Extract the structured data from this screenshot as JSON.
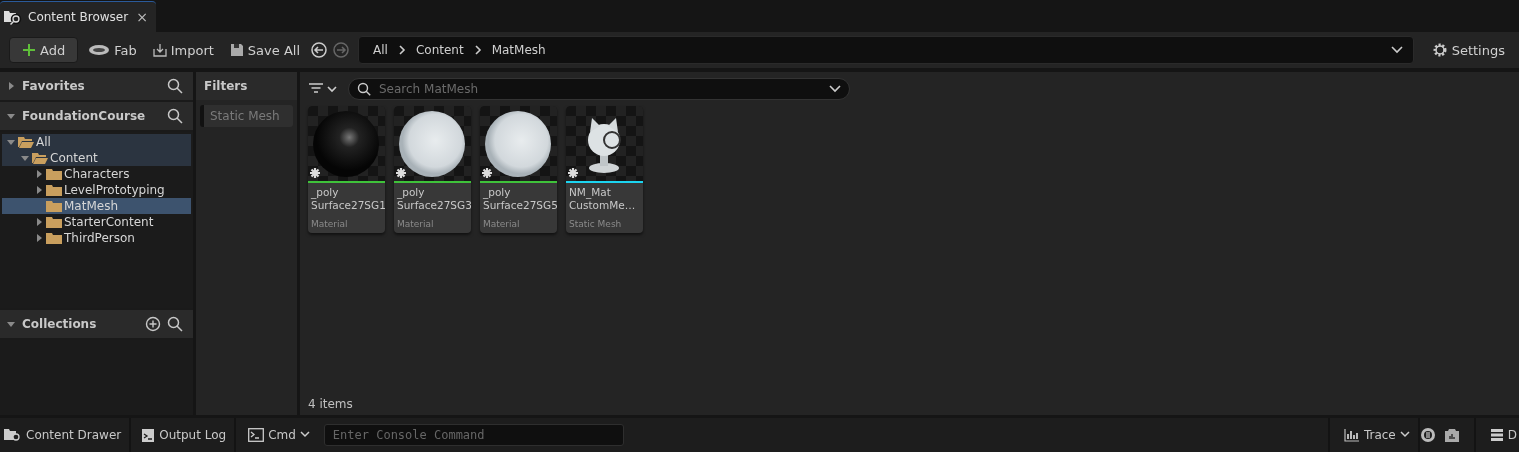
{
  "tab": {
    "title": "Content Browser",
    "close": "×"
  },
  "toolbar": {
    "buttons": [
      {
        "kind": "add",
        "label": "Add"
      },
      {
        "kind": "fab",
        "label": "Fab"
      },
      {
        "kind": "import",
        "label": "Import"
      },
      {
        "kind": "save",
        "label": "Save All"
      }
    ],
    "breadcrumb": [
      "All",
      "Content",
      "MatMesh"
    ],
    "settings": "Settings"
  },
  "sidebar": {
    "favorites": {
      "title": "Favorites",
      "expanded": false
    },
    "project": {
      "title": "FoundationCourse",
      "expanded": true
    },
    "tree": [
      {
        "label": "All",
        "expanded": true,
        "selected": false,
        "children": [
          {
            "label": "Content",
            "expanded": true,
            "selected": false,
            "children": [
              {
                "label": "Characters",
                "expanded": false,
                "selected": false
              },
              {
                "label": "LevelPrototyping",
                "expanded": false,
                "selected": false
              },
              {
                "label": "MatMesh",
                "selected": true
              },
              {
                "label": "StarterContent",
                "expanded": false,
                "selected": false
              },
              {
                "label": "ThirdPerson",
                "expanded": false,
                "selected": false
              }
            ]
          }
        ]
      }
    ],
    "collections": {
      "title": "Collections",
      "expanded": true
    }
  },
  "filters": {
    "title": "Filters",
    "chips": [
      {
        "label": "Static Mesh",
        "checked": false
      }
    ]
  },
  "search": {
    "placeholder": "Search MatMesh"
  },
  "assets": [
    {
      "kind": "dark-sphere",
      "name": "_poly Surface27SG1",
      "type": "Material",
      "color": "#3fc23a"
    },
    {
      "kind": "light-sphere",
      "name": "_poly Surface27SG3",
      "type": "Material",
      "color": "#3fc23a"
    },
    {
      "kind": "light-sphere",
      "name": "_poly Surface27SG5",
      "type": "Material",
      "color": "#3fc23a"
    },
    {
      "kind": "mesh",
      "name": "NM_Mat CustomMe…",
      "type": "Static Mesh",
      "color": "#1cd4f0"
    }
  ],
  "item_count": "4 items",
  "status_bar": {
    "content_drawer": "Content Drawer",
    "output_log": "Output Log",
    "cmd": "Cmd",
    "console_placeholder": "Enter Console Command",
    "trace": "Trace",
    "last": "D"
  }
}
